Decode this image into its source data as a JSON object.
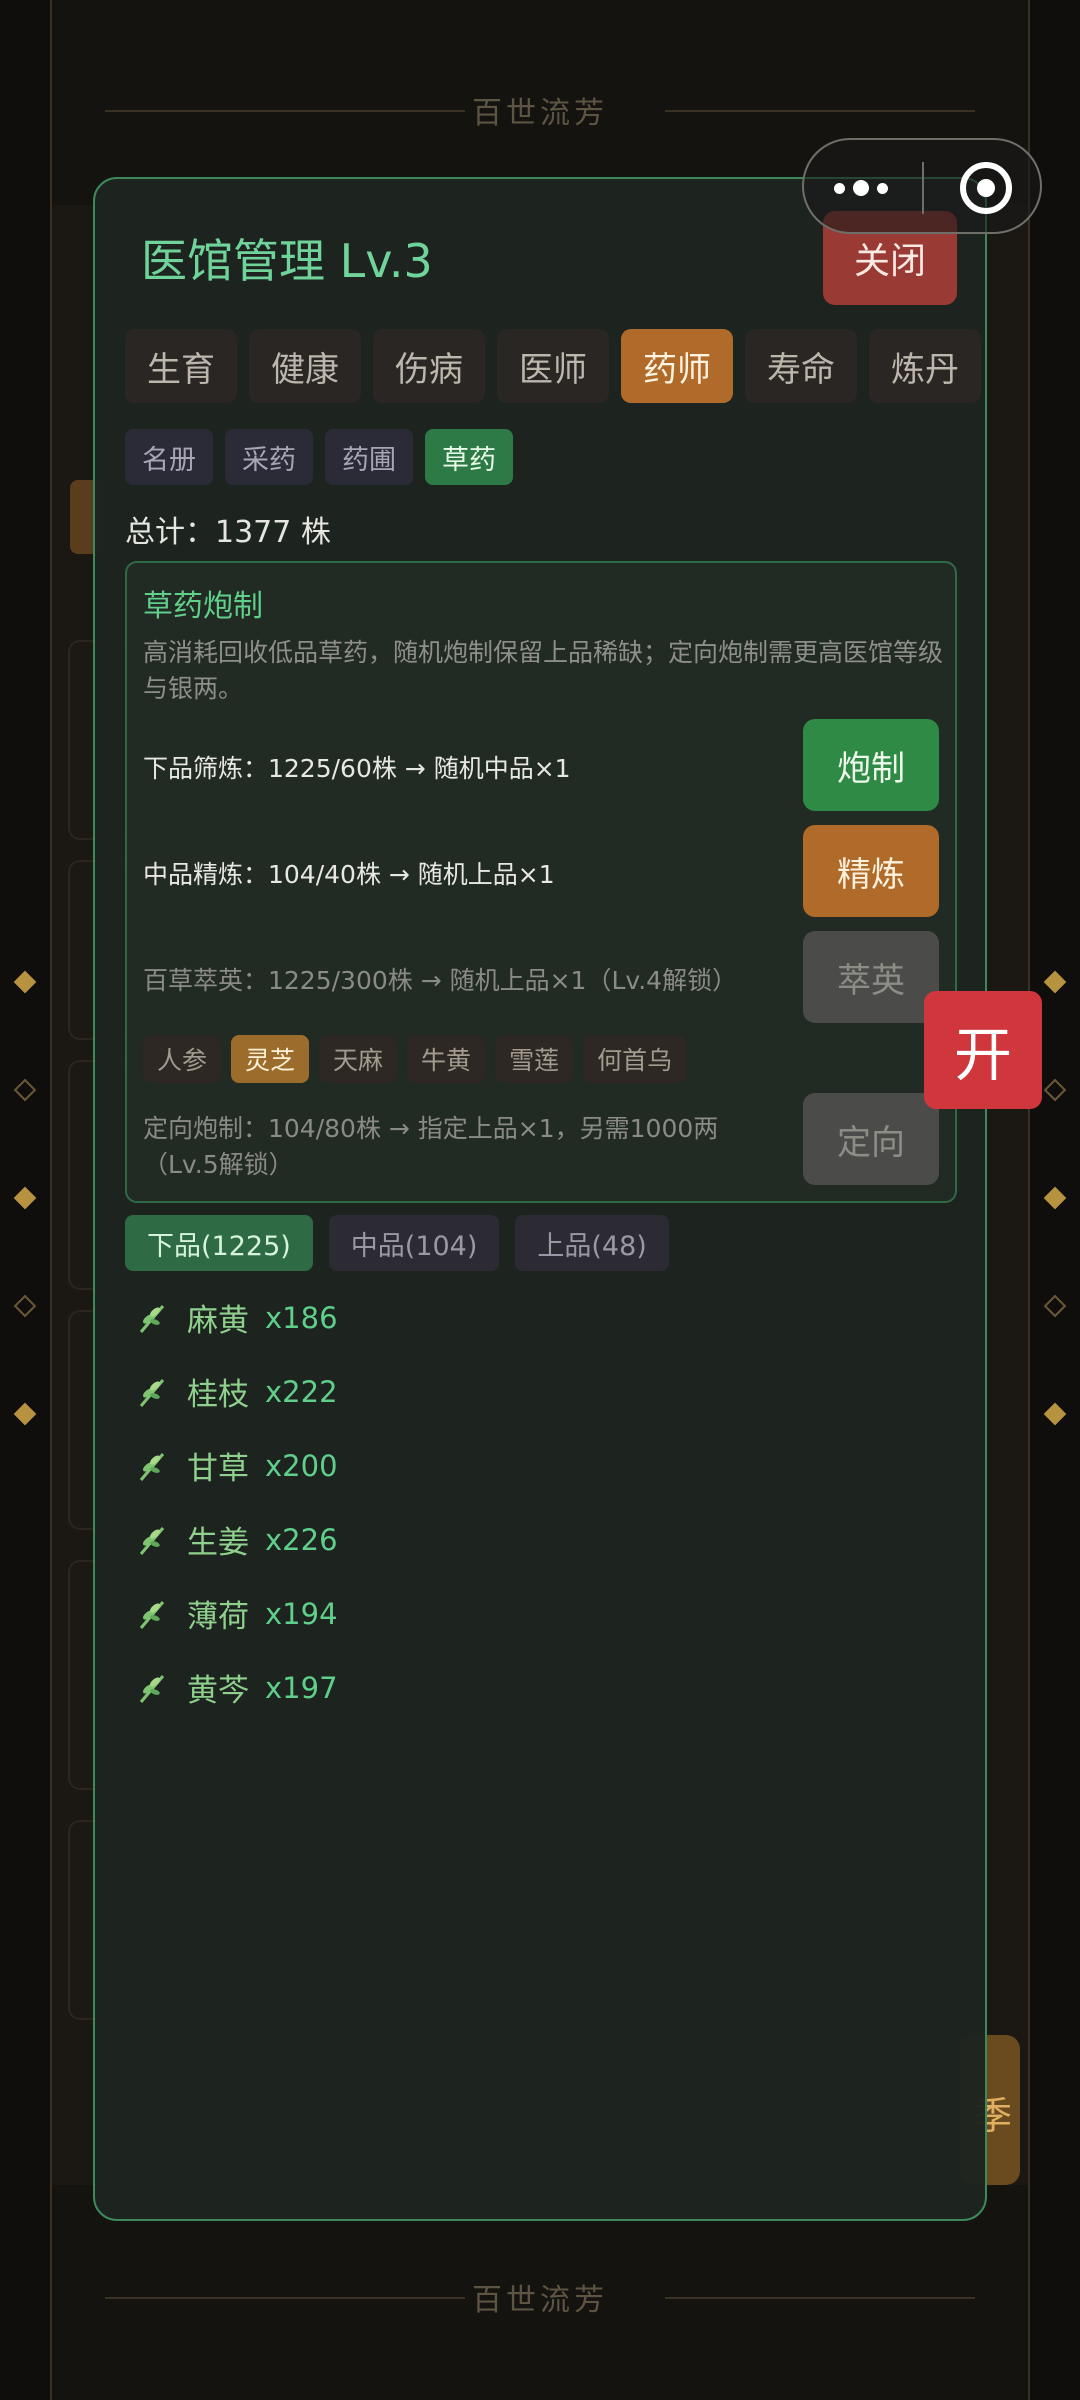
{
  "background": {
    "title_top": "百世流芳",
    "title_bottom": "百世流芳",
    "bottom_right_text": "季"
  },
  "modal": {
    "title": "医馆管理 Lv.3",
    "close_label": "关闭",
    "main_tabs": [
      "生育",
      "健康",
      "伤病",
      "医师",
      "药师",
      "寿命",
      "炼丹"
    ],
    "main_tab_active": "药师",
    "sub_tabs": [
      "名册",
      "采药",
      "药圃",
      "草药"
    ],
    "sub_tab_active": "草药",
    "total": "总计：1377 株",
    "process": {
      "title": "草药炮制",
      "description": "高消耗回收低品草药，随机炮制保留上品稀缺；定向炮制需更高医馆等级与银两。",
      "rows": [
        {
          "label": "下品筛炼：1225/60株 → 随机中品×1",
          "button": "炮制",
          "state": "enabled"
        },
        {
          "label": "中品精炼：104/40株 → 随机上品×1",
          "button": "精炼",
          "state": "enabled"
        },
        {
          "label": "百草萃英：1225/300株 → 随机上品×1（Lv.4解锁）",
          "button": "萃英",
          "state": "locked"
        }
      ],
      "herb_chips": [
        "人参",
        "灵芝",
        "天麻",
        "牛黄",
        "雪莲",
        "何首乌"
      ],
      "herb_chip_active": "灵芝",
      "directed": {
        "label": "定向炮制：104/80株 → 指定上品×1，另需1000两（Lv.5解锁）",
        "button": "定向",
        "state": "locked"
      }
    },
    "grade_tabs": [
      "下品(1225)",
      "中品(104)",
      "上品(48)"
    ],
    "grade_tab_active": "下品(1225)",
    "herbs": [
      {
        "name": "麻黄",
        "count": "x186"
      },
      {
        "name": "桂枝",
        "count": "x222"
      },
      {
        "name": "甘草",
        "count": "x200"
      },
      {
        "name": "生姜",
        "count": "x226"
      },
      {
        "name": "薄荷",
        "count": "x194"
      },
      {
        "name": "黄芩",
        "count": "x197"
      }
    ]
  },
  "floating_button": "开",
  "icons": {
    "herb": "herb-sprig-icon",
    "menu": "more-dots-icon",
    "close_miniprogram": "target-circle-icon"
  },
  "colors": {
    "accent_green": "#5fcf8a",
    "active_orange": "#b06b2a",
    "danger_red": "#d0373c",
    "close_red": "#9a3a34"
  }
}
